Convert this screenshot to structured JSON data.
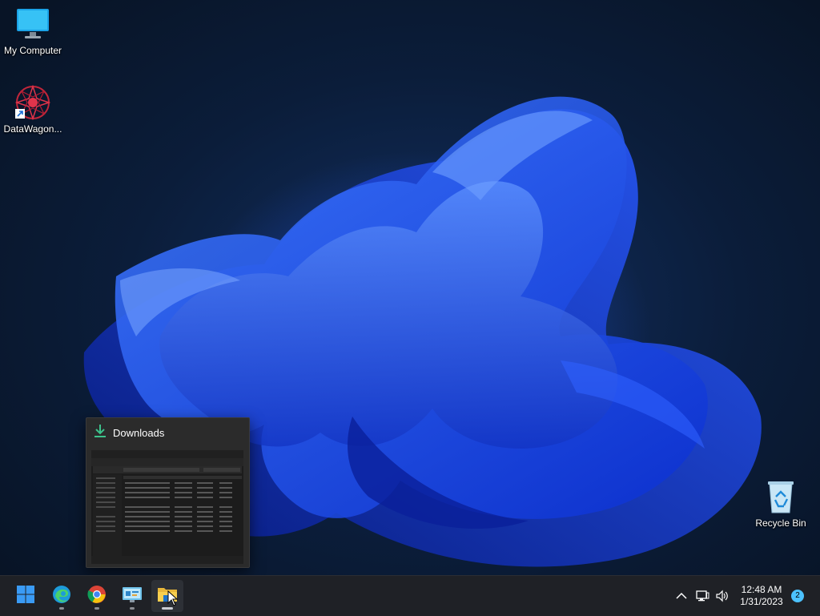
{
  "desktop": {
    "icons": [
      {
        "label": "My Computer",
        "icon": "monitor-icon"
      },
      {
        "label": "DataWagon...",
        "icon": "datawagon-shortcut-icon"
      },
      {
        "label": "Recycle Bin",
        "icon": "recycle-bin-icon"
      }
    ]
  },
  "preview": {
    "title": "Downloads",
    "icon": "download-arrow-icon",
    "accent": "#3cc28b"
  },
  "taskbar": {
    "buttons": [
      {
        "name": "start",
        "icon": "windows-logo-icon"
      },
      {
        "name": "edge",
        "icon": "edge-icon"
      },
      {
        "name": "chrome",
        "icon": "chrome-icon"
      },
      {
        "name": "control-panel",
        "icon": "control-panel-icon"
      },
      {
        "name": "file-explorer",
        "icon": "folder-icon",
        "active": true
      }
    ],
    "tray": {
      "chevron": "chevron-up-icon",
      "network": "network-icon",
      "volume": "volume-icon"
    },
    "clock": {
      "time": "12:48 AM",
      "date": "1/31/2023"
    },
    "notification_count": "2",
    "colors": {
      "start_blue": "#3a9bf5",
      "notif_badge": "#4cc2ff"
    }
  }
}
